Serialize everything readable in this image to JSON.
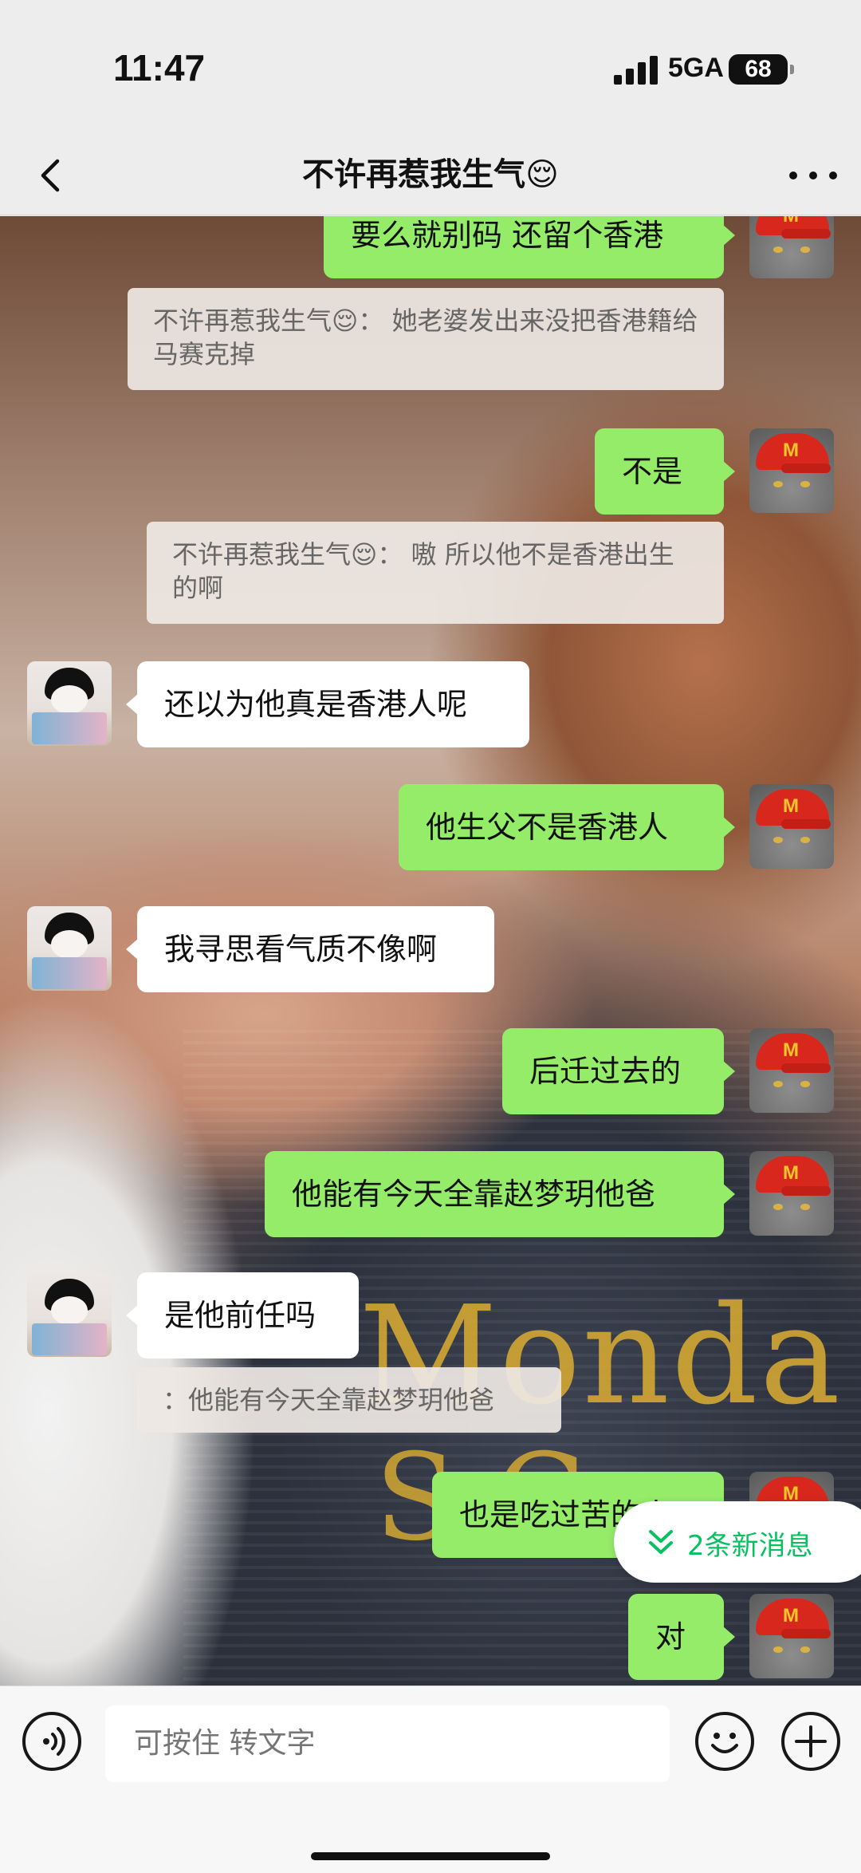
{
  "status": {
    "time": "11:47",
    "network": "5GA",
    "battery": "68"
  },
  "header": {
    "title": "不许再惹我生气😌"
  },
  "messages": [
    {
      "sender": "me",
      "text": "要么就别码 还留个香港"
    },
    {
      "type": "quote",
      "text": "不许再惹我生气😌： 她老婆发出来没把香港籍给马赛克掉"
    },
    {
      "sender": "me",
      "text": "不是"
    },
    {
      "type": "quote",
      "text": "不许再惹我生气😌： 嗷 所以他不是香港出生的啊"
    },
    {
      "sender": "other",
      "text": "还以为他真是香港人呢"
    },
    {
      "sender": "me",
      "text": "他生父不是香港人"
    },
    {
      "sender": "other",
      "text": "我寻思看气质不像啊"
    },
    {
      "sender": "me",
      "text": "后迁过去的"
    },
    {
      "sender": "me",
      "text": "他能有今天全靠赵梦玥他爸"
    },
    {
      "sender": "other",
      "text": "是他前任吗"
    },
    {
      "type": "quote",
      "text": "：他能有今天全靠赵梦玥他爸"
    },
    {
      "sender": "me",
      "text": "也是吃过苦的人"
    },
    {
      "sender": "me",
      "text": "对"
    }
  ],
  "new_messages": {
    "label": "2条新消息"
  },
  "input": {
    "placeholder": "可按住 转文字"
  },
  "background": {
    "shirt_text_1": "Monda",
    "shirt_text_2": "S C"
  },
  "icons": {
    "back": "chevron-left-icon",
    "more": "more-dots-icon",
    "voice": "voice-icon",
    "emoji": "emoji-icon",
    "plus": "plus-icon",
    "new_messages": "double-chevron-down-icon"
  },
  "colors": {
    "my_bubble": "#95ec69",
    "other_bubble": "#ffffff",
    "accent": "#07c160"
  }
}
